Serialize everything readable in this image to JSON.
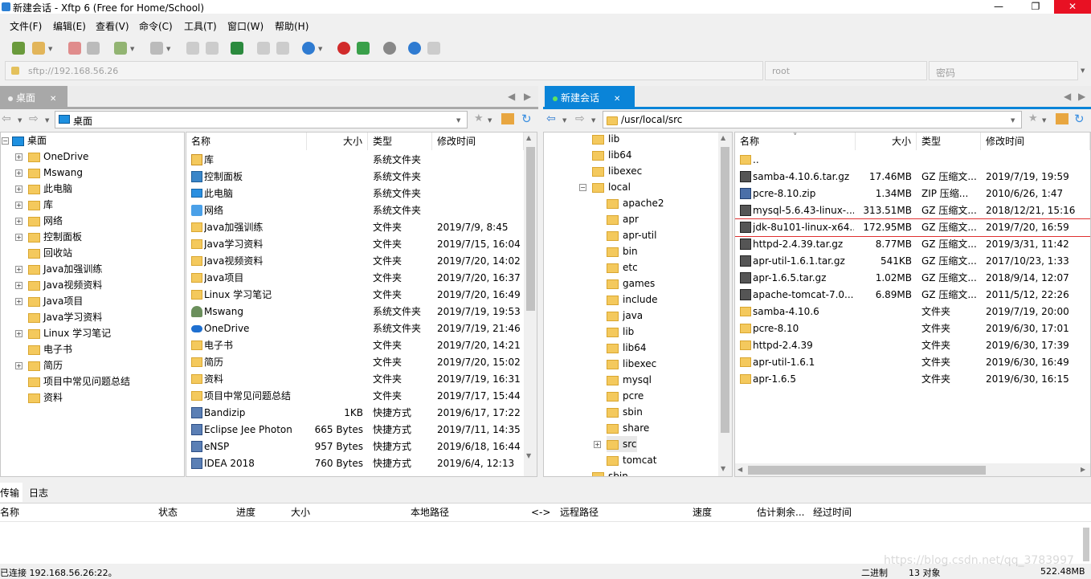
{
  "window": {
    "title": "新建会话 - Xftp 6 (Free for Home/School)",
    "min": "—",
    "max": "❐",
    "close": "✕"
  },
  "menu": [
    "文件(F)",
    "编辑(E)",
    "查看(V)",
    "命令(C)",
    "工具(T)",
    "窗口(W)",
    "帮助(H)"
  ],
  "address": {
    "host_placeholder": "sftp://192.168.56.26",
    "user": "root",
    "password_placeholder": "密码"
  },
  "left": {
    "tab": "桌面",
    "path": "桌面",
    "tree": [
      "桌面",
      "OneDrive",
      "Mswang",
      "此电脑",
      "库",
      "网络",
      "控制面板",
      "回收站",
      "Java加强训练",
      "Java视频资料",
      "Java项目",
      "Java学习资料",
      "Linux 学习笔记",
      "电子书",
      "简历",
      "项目中常见问题总结",
      "资料"
    ],
    "columns": {
      "name": "名称",
      "size": "大小",
      "type": "类型",
      "modified": "修改时间"
    },
    "files": [
      {
        "name": "库",
        "size": "",
        "type": "系统文件夹",
        "modified": "",
        "icon": "library-icon"
      },
      {
        "name": "控制面板",
        "size": "",
        "type": "系统文件夹",
        "modified": "",
        "icon": "control-panel-icon"
      },
      {
        "name": "此电脑",
        "size": "",
        "type": "系统文件夹",
        "modified": "",
        "icon": "computer-icon"
      },
      {
        "name": "网络",
        "size": "",
        "type": "系统文件夹",
        "modified": "",
        "icon": "network-icon"
      },
      {
        "name": "Java加强训练",
        "size": "",
        "type": "文件夹",
        "modified": "2019/7/9, 8:45",
        "icon": "folder-icon"
      },
      {
        "name": "Java学习资料",
        "size": "",
        "type": "文件夹",
        "modified": "2019/7/15, 16:04",
        "icon": "folder-icon"
      },
      {
        "name": "Java视频资料",
        "size": "",
        "type": "文件夹",
        "modified": "2019/7/20, 14:02",
        "icon": "folder-icon"
      },
      {
        "name": "Java项目",
        "size": "",
        "type": "文件夹",
        "modified": "2019/7/20, 16:37",
        "icon": "folder-icon"
      },
      {
        "name": "Linux 学习笔记",
        "size": "",
        "type": "文件夹",
        "modified": "2019/7/20, 16:49",
        "icon": "folder-icon"
      },
      {
        "name": "Mswang",
        "size": "",
        "type": "系统文件夹",
        "modified": "2019/7/19, 19:53",
        "icon": "user-icon"
      },
      {
        "name": "OneDrive",
        "size": "",
        "type": "系统文件夹",
        "modified": "2019/7/19, 21:46",
        "icon": "cloud-icon"
      },
      {
        "name": "电子书",
        "size": "",
        "type": "文件夹",
        "modified": "2019/7/20, 14:21",
        "icon": "folder-icon"
      },
      {
        "name": "简历",
        "size": "",
        "type": "文件夹",
        "modified": "2019/7/20, 15:02",
        "icon": "folder-icon"
      },
      {
        "name": "资料",
        "size": "",
        "type": "文件夹",
        "modified": "2019/7/19, 16:31",
        "icon": "folder-icon"
      },
      {
        "name": "项目中常见问题总结",
        "size": "",
        "type": "文件夹",
        "modified": "2019/7/17, 15:44",
        "icon": "folder-icon"
      },
      {
        "name": "Bandizip",
        "size": "1KB",
        "type": "快捷方式",
        "modified": "2019/6/17, 17:22",
        "icon": "shortcut-icon"
      },
      {
        "name": "Eclipse Jee Photon",
        "size": "665 Bytes",
        "type": "快捷方式",
        "modified": "2019/7/11, 14:35",
        "icon": "shortcut-icon"
      },
      {
        "name": "eNSP",
        "size": "957 Bytes",
        "type": "快捷方式",
        "modified": "2019/6/18, 16:44",
        "icon": "shortcut-icon"
      },
      {
        "name": "IDEA 2018",
        "size": "760 Bytes",
        "type": "快捷方式",
        "modified": "2019/6/4, 12:13",
        "icon": "shortcut-icon"
      }
    ]
  },
  "right": {
    "tab": "新建会话",
    "path": "/usr/local/src",
    "tree": [
      "lib",
      "lib64",
      "libexec",
      "local",
      "apache2",
      "apr",
      "apr-util",
      "bin",
      "etc",
      "games",
      "include",
      "java",
      "lib",
      "lib64",
      "libexec",
      "mysql",
      "pcre",
      "sbin",
      "share",
      "src",
      "tomcat",
      "sbin"
    ],
    "columns": {
      "name": "名称",
      "size": "大小",
      "type": "类型",
      "modified": "修改时间"
    },
    "files": [
      {
        "name": "..",
        "size": "",
        "type": "",
        "modified": "",
        "icon": "folder-icon"
      },
      {
        "name": "samba-4.10.6.tar.gz",
        "size": "17.46MB",
        "type": "GZ 压缩文...",
        "modified": "2019/7/19, 19:59",
        "icon": "archive-icon"
      },
      {
        "name": "pcre-8.10.zip",
        "size": "1.34MB",
        "type": "ZIP 压缩...",
        "modified": "2010/6/26, 1:47",
        "icon": "zip-icon"
      },
      {
        "name": "mysql-5.6.43-linux-...",
        "size": "313.51MB",
        "type": "GZ 压缩文...",
        "modified": "2018/12/21, 15:16",
        "icon": "archive-icon"
      },
      {
        "name": "jdk-8u101-linux-x64...",
        "size": "172.95MB",
        "type": "GZ 压缩文...",
        "modified": "2019/7/20, 16:59",
        "icon": "archive-icon",
        "highlight": true
      },
      {
        "name": "httpd-2.4.39.tar.gz",
        "size": "8.77MB",
        "type": "GZ 压缩文...",
        "modified": "2019/3/31, 11:42",
        "icon": "archive-icon"
      },
      {
        "name": "apr-util-1.6.1.tar.gz",
        "size": "541KB",
        "type": "GZ 压缩文...",
        "modified": "2017/10/23, 1:33",
        "icon": "archive-icon"
      },
      {
        "name": "apr-1.6.5.tar.gz",
        "size": "1.02MB",
        "type": "GZ 压缩文...",
        "modified": "2018/9/14, 12:07",
        "icon": "archive-icon"
      },
      {
        "name": "apache-tomcat-7.0....",
        "size": "6.89MB",
        "type": "GZ 压缩文...",
        "modified": "2011/5/12, 22:26",
        "icon": "archive-icon"
      },
      {
        "name": "samba-4.10.6",
        "size": "",
        "type": "文件夹",
        "modified": "2019/7/19, 20:00",
        "icon": "folder-icon"
      },
      {
        "name": "pcre-8.10",
        "size": "",
        "type": "文件夹",
        "modified": "2019/6/30, 17:01",
        "icon": "folder-icon"
      },
      {
        "name": "httpd-2.4.39",
        "size": "",
        "type": "文件夹",
        "modified": "2019/6/30, 17:39",
        "icon": "folder-icon"
      },
      {
        "name": "apr-util-1.6.1",
        "size": "",
        "type": "文件夹",
        "modified": "2019/6/30, 16:49",
        "icon": "folder-icon"
      },
      {
        "name": "apr-1.6.5",
        "size": "",
        "type": "文件夹",
        "modified": "2019/6/30, 16:15",
        "icon": "folder-icon"
      }
    ]
  },
  "transfer": {
    "tabs": [
      "传输",
      "日志"
    ],
    "columns": [
      "名称",
      "状态",
      "进度",
      "大小",
      "本地路径",
      "<->",
      "远程路径",
      "速度",
      "估计剩余...",
      "经过时间"
    ]
  },
  "status": {
    "connection": "已连接 192.168.56.26:22。",
    "mode": "二进制",
    "count": "13 对象",
    "size": "522.48MB",
    "watermark": "https://blog.csdn.net/qq_3783997"
  },
  "colors": {
    "accent": "#0a84d8",
    "highlight_border": "#e03030"
  }
}
